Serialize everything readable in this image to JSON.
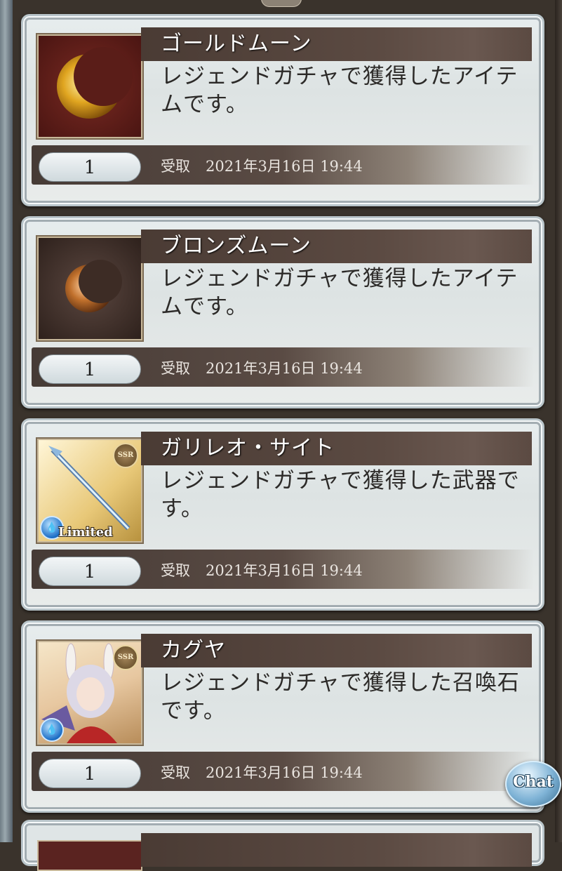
{
  "items": [
    {
      "name": "ゴールドムーン",
      "description": "レジェンドガチャで獲得したアイテムです。",
      "quantity": "1",
      "status": "受取",
      "timestamp": "2021年3月16日 19:44",
      "icon": "gold-moon-icon"
    },
    {
      "name": "ブロンズムーン",
      "description": "レジェンドガチャで獲得したアイテムです。",
      "quantity": "1",
      "status": "受取",
      "timestamp": "2021年3月16日 19:44",
      "icon": "bronze-moon-icon"
    },
    {
      "name": "ガリレオ・サイト",
      "description": "レジェンドガチャで獲得した武器です。",
      "quantity": "1",
      "status": "受取",
      "timestamp": "2021年3月16日 19:44",
      "icon": "weapon-icon",
      "rarity": "SSR",
      "tag": "Limited"
    },
    {
      "name": "カグヤ",
      "description": "レジェンドガチャで獲得した召喚石です。",
      "quantity": "1",
      "status": "受取",
      "timestamp": "2021年3月16日 19:44",
      "icon": "summon-portrait-icon",
      "rarity": "SSR"
    }
  ],
  "chat_button": {
    "label": "Chat"
  },
  "colors": {
    "title_bar": "#4a3b34",
    "card_bg": "#e7edee",
    "page_bg": "#3a332c"
  }
}
